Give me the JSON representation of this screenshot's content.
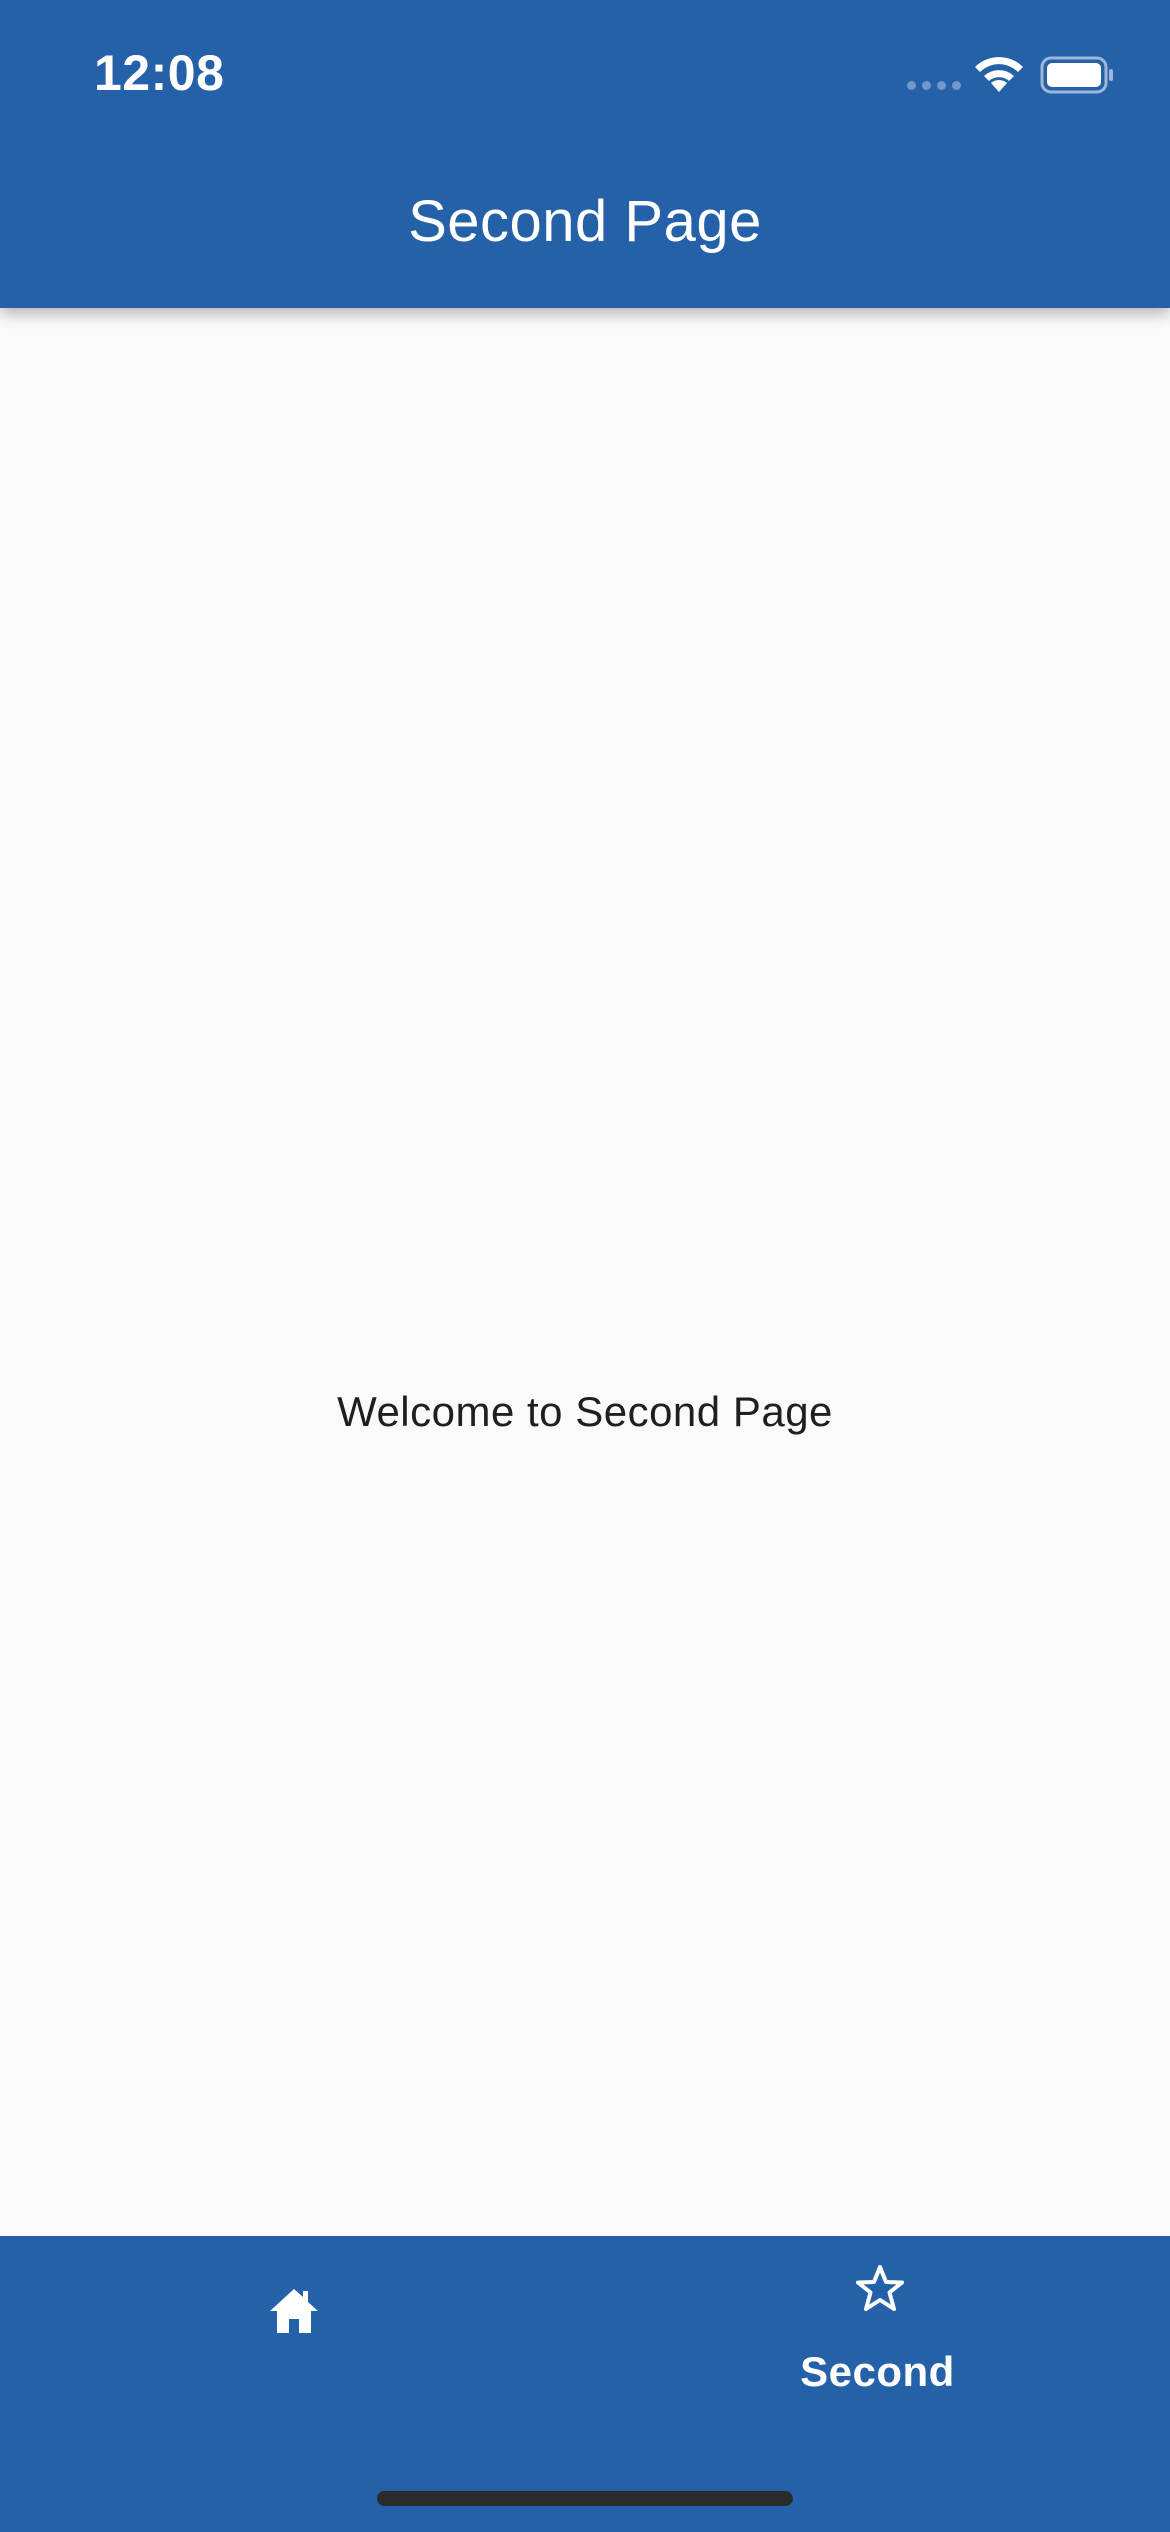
{
  "status_bar": {
    "time": "12:08"
  },
  "app_bar": {
    "title": "Second Page",
    "background_color": "#2561a8"
  },
  "main": {
    "welcome_text": "Welcome to Second Page",
    "background_color": "#fafafa"
  },
  "bottom_nav": {
    "background_color": "#2561a8",
    "items": [
      {
        "icon": "home-icon",
        "label": "",
        "selected": false
      },
      {
        "icon": "star-outline-icon",
        "label": "Second",
        "selected": true
      }
    ]
  }
}
